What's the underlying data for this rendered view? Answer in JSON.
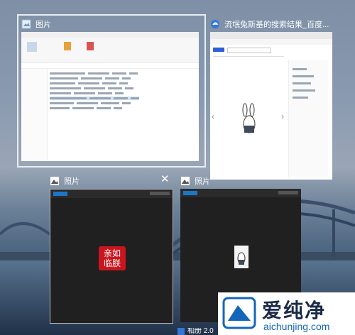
{
  "windows": [
    {
      "id": "explorer",
      "title": "图片",
      "icon": "folder-picture-icon"
    },
    {
      "id": "edge",
      "title": "流氓兔斯基的搜索结果_百度...",
      "icon": "edge-browser-icon"
    },
    {
      "id": "photos1",
      "title": "照片",
      "icon": "photos-app-icon"
    },
    {
      "id": "photos2",
      "title": "照片",
      "icon": "photos-app-icon"
    }
  ],
  "stamp_text": "亲如临朕",
  "taskbar_partial": "相册 2.0",
  "watermark": {
    "name": "爱纯净",
    "url": "aichunjing.com"
  },
  "colors": {
    "accent": "#1c77c9",
    "edge_blue": "#3277d8",
    "stamp_red": "#c9151e",
    "photos_dark": "#202020"
  }
}
